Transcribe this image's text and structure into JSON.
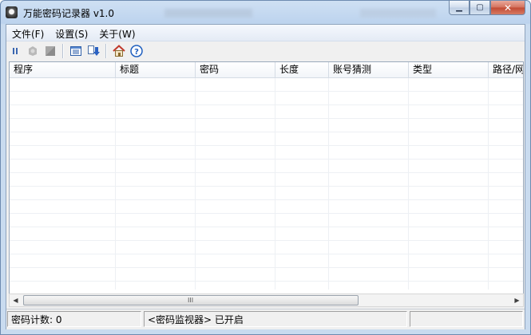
{
  "window": {
    "title": "万能密码记录器 v1.0"
  },
  "titlebar": {
    "min_icon": "minimize-icon",
    "max_icon": "maximize-icon",
    "close_icon": "close-icon",
    "min_glyph": "▁",
    "max_glyph": "▢",
    "close_glyph": "✕"
  },
  "menu": [
    {
      "label": "文件(F)"
    },
    {
      "label": "设置(S)"
    },
    {
      "label": "关于(W)"
    }
  ],
  "toolbar": {
    "icons": [
      "pause-icon",
      "clear-icon",
      "stop-icon",
      "list-view-icon",
      "export-icon",
      "home-icon",
      "help-icon"
    ]
  },
  "table": {
    "columns": [
      "程序",
      "标题",
      "密码",
      "长度",
      "账号猜测",
      "类型",
      "路径/网"
    ],
    "rows": []
  },
  "scrollbar": {
    "grip": "III",
    "left_arrow": "◀",
    "right_arrow": "▶"
  },
  "status": {
    "count_label": "密码计数: 0",
    "monitor_status": "<密码监视器> 已开启",
    "extra": ""
  },
  "colors": {
    "title_bg": "#bcd3ee",
    "close_button": "#c24a33",
    "grid_line": "#edf0f4"
  }
}
